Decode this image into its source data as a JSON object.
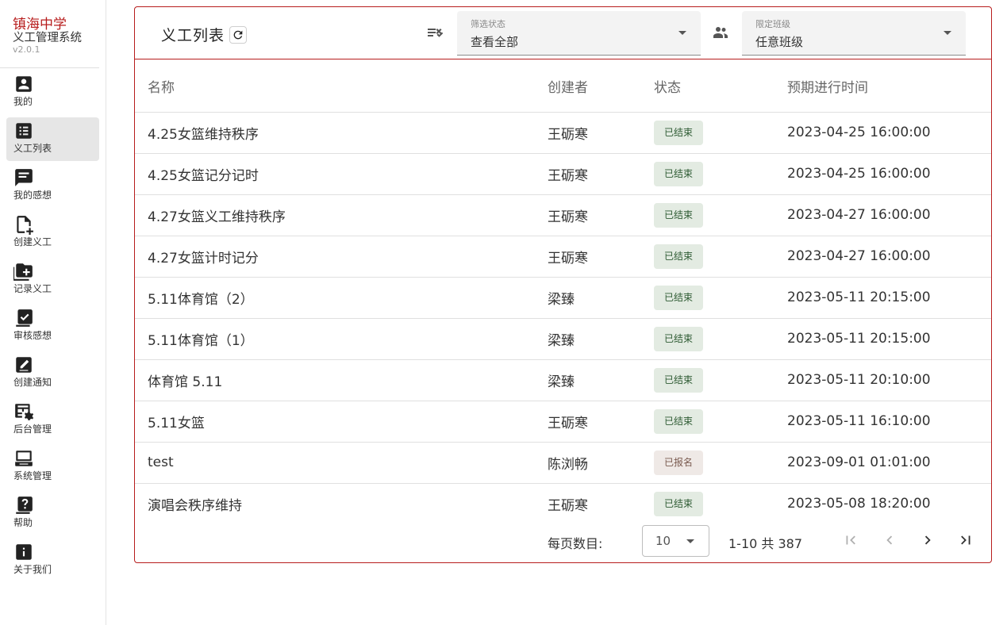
{
  "brand": {
    "school": "镇海中学",
    "system": "义工管理系统",
    "version": "v2.0.1"
  },
  "nav": [
    {
      "label": "我的",
      "icon": "account-box-icon",
      "active": false
    },
    {
      "label": "义工列表",
      "icon": "list-icon",
      "active": true
    },
    {
      "label": "我的感想",
      "icon": "message-text-icon",
      "active": false
    },
    {
      "label": "创建义工",
      "icon": "file-plus-icon",
      "active": false
    },
    {
      "label": "记录义工",
      "icon": "folder-plus-icon",
      "active": false
    },
    {
      "label": "审核感想",
      "icon": "checkbox-list-icon",
      "active": false
    },
    {
      "label": "创建通知",
      "icon": "draw-icon",
      "active": false
    },
    {
      "label": "后台管理",
      "icon": "table-cog-icon",
      "active": false
    },
    {
      "label": "系统管理",
      "icon": "laptop-icon",
      "active": false
    },
    {
      "label": "帮助",
      "icon": "help-box-icon",
      "active": false
    },
    {
      "label": "关于我们",
      "icon": "info-box-icon",
      "active": false
    }
  ],
  "toolbar": {
    "title": "义工列表",
    "status_filter": {
      "label": "筛选状态",
      "value": "查看全部"
    },
    "class_filter": {
      "label": "限定班级",
      "value": "任意班级"
    }
  },
  "table": {
    "headers": {
      "name": "名称",
      "creator": "创建者",
      "status": "状态",
      "time": "预期进行时间"
    },
    "rows": [
      {
        "name": "4.25女篮维持秩序",
        "creator": "王砺寒",
        "status": "已结束",
        "time": "2023-04-25 16:00:00"
      },
      {
        "name": "4.25女篮记分记时",
        "creator": "王砺寒",
        "status": "已结束",
        "time": "2023-04-25 16:00:00"
      },
      {
        "name": "4.27女篮义工维持秩序",
        "creator": "王砺寒",
        "status": "已结束",
        "time": "2023-04-27 16:00:00"
      },
      {
        "name": "4.27女篮计时记分",
        "creator": "王砺寒",
        "status": "已结束",
        "time": "2023-04-27 16:00:00"
      },
      {
        "name": "5.11体育馆（2）",
        "creator": "梁臻",
        "status": "已结束",
        "time": "2023-05-11 20:15:00"
      },
      {
        "name": "5.11体育馆（1）",
        "creator": "梁臻",
        "status": "已结束",
        "time": "2023-05-11 20:15:00"
      },
      {
        "name": "体育馆 5.11",
        "creator": "梁臻",
        "status": "已结束",
        "time": "2023-05-11 20:10:00"
      },
      {
        "name": "5.11女篮",
        "creator": "王砺寒",
        "status": "已结束",
        "time": "2023-05-11 16:10:00"
      },
      {
        "name": "test",
        "creator": "陈浏畅",
        "status": "已报名",
        "time": "2023-09-01 01:01:00"
      },
      {
        "name": "演唱会秩序维持",
        "creator": "王砺寒",
        "status": "已结束",
        "time": "2023-05-08 18:20:00"
      }
    ]
  },
  "pagination": {
    "per_page_label": "每页数目:",
    "per_page": "10",
    "range": "1-10 共 387"
  },
  "colors": {
    "accent": "#b71c1c",
    "chip_done_bg": "#e3ebe2",
    "chip_signed_bg": "#efe9e6"
  }
}
